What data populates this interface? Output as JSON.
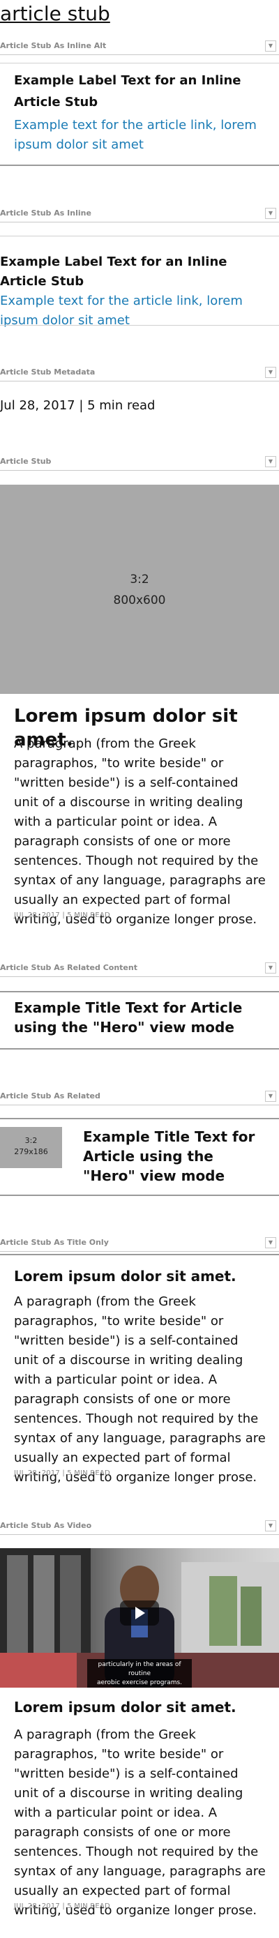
{
  "page": {
    "title": "article stub"
  },
  "sections": {
    "inline_alt": {
      "heading": "Article Stub As Inline Alt",
      "toggle": "▼",
      "label": "Example Label Text for an Inline Article Stub",
      "link": "Example text for the article link, lorem ipsum dolor sit amet"
    },
    "inline": {
      "heading": "Article Stub As Inline",
      "toggle": "▼",
      "label": "Example Label Text for an Inline Article Stub",
      "link": "Example text for the article link, lorem ipsum dolor sit amet"
    },
    "metadata": {
      "heading": "Article Stub Metadata",
      "toggle": "▼",
      "text": "Jul 28, 2017 | 5 min read"
    },
    "stub": {
      "heading": "Article Stub",
      "toggle": "▼",
      "image_ratio": "3:2",
      "image_size": "800x600",
      "title": "Lorem ipsum dolor sit amet.",
      "body": "A paragraph (from the Greek paragraphos, \"to write beside\" or \"written beside\") is a self-contained unit of a discourse in writing dealing with a particular point or idea. A paragraph consists of one or more sentences. Though not required by the syntax of any language, paragraphs are usually an expected part of formal writing, used to organize longer prose.",
      "meta": "JUL 28, 2017 | 5 MIN READ"
    },
    "related_content": {
      "heading": "Article Stub As Related Content",
      "toggle": "▼",
      "title": "Example Title Text for Article using the \"Hero\" view mode"
    },
    "related": {
      "heading": "Article Stub As Related",
      "toggle": "▼",
      "image_ratio": "3:2",
      "image_size": "279x186",
      "title": "Example Title Text for Article using the \"Hero\" view mode"
    },
    "title_only": {
      "heading": "Article Stub As Title Only",
      "toggle": "▼",
      "title": "Lorem ipsum dolor sit amet.",
      "body": "A paragraph (from the Greek paragraphos, \"to write beside\" or \"written beside\") is a self-contained unit of a discourse in writing dealing with a particular point or idea. A paragraph consists of one or more sentences. Though not required by the syntax of any language, paragraphs are usually an expected part of formal writing, used to organize longer prose.",
      "meta": "JUL 28, 2017 | 5 MIN READ"
    },
    "video": {
      "heading": "Article Stub As Video",
      "toggle": "▼",
      "caption_line1": "particularly in the areas of routine",
      "caption_line2": "aerobic exercise programs.",
      "title": "Lorem ipsum dolor sit amet.",
      "body": "A paragraph (from the Greek paragraphos, \"to write beside\" or \"written beside\") is a self-contained unit of a discourse in writing dealing with a particular point or idea. A paragraph consists of one or more sentences. Though not required by the syntax of any language, paragraphs are usually an expected part of formal writing, used to organize longer prose.",
      "meta": "JUL 28, 2017 | 5 MIN READ"
    }
  }
}
